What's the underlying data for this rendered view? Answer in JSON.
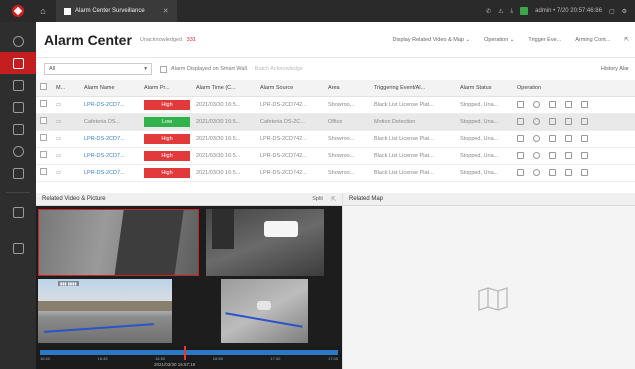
{
  "topbar": {
    "module_tab": "Alarm Center Surveillance",
    "user_text": "admin • 7/20 20:57:46:86"
  },
  "header": {
    "title": "Alarm Center",
    "subtitle": "Unacknowledged",
    "count": "331",
    "actions": [
      "Display Related Video & Map ⌄",
      "Operation ⌄",
      "Trigger Eve...",
      "Arming Cont...",
      "⇱"
    ]
  },
  "filter": {
    "select_value": "All",
    "smartwall_label": "Alarm Displayed on Smart Wall",
    "batch_label": "Batch Acknowledge",
    "history_label": "History Alar"
  },
  "table": {
    "columns": [
      "",
      "M...",
      "Alarm Name",
      "Alarm Pr...",
      "Alarm Time (C...",
      "Alarm Source",
      "Area",
      "Triggering Event/Al...",
      "Alarm Status",
      "Operation"
    ],
    "rows": [
      {
        "name": "LPR-DS-2CD7...",
        "priority": "High",
        "prio_class": "high",
        "time": "2021/03/30 16:5...",
        "source": "LPR-DS-2CD742...",
        "area": "Showroo...",
        "event": "Black List License Plat...",
        "status": "Stopped, Una...",
        "selected": false,
        "link": true
      },
      {
        "name": "Cafeteria DS...",
        "priority": "Low",
        "prio_class": "low",
        "time": "2021/03/30 16:5...",
        "source": "Cafeteria DS-2C...",
        "area": "Office",
        "event": "Motion Detection",
        "status": "Stopped, Una...",
        "selected": true,
        "link": false
      },
      {
        "name": "LPR-DS-2CD7...",
        "priority": "High",
        "prio_class": "high",
        "time": "2021/03/30 16:5...",
        "source": "LPR-DS-2CD742...",
        "area": "Showroo...",
        "event": "Black List License Plat...",
        "status": "Stopped, Una...",
        "selected": false,
        "link": true
      },
      {
        "name": "LPR-DS-2CD7...",
        "priority": "High",
        "prio_class": "high",
        "time": "2021/03/30 16:5...",
        "source": "LPR-DS-2CD742...",
        "area": "Showroo...",
        "event": "Black List License Plat...",
        "status": "Stopped, Una...",
        "selected": false,
        "link": true
      },
      {
        "name": "LPR-DS-2CD7...",
        "priority": "High",
        "prio_class": "high",
        "time": "2021/03/30 16:5...",
        "source": "LPR-DS-2CD742...",
        "area": "Showroo...",
        "event": "Black List License Plat...",
        "status": "Stopped, Una...",
        "selected": false,
        "link": true
      }
    ]
  },
  "video_panel": {
    "title": "Related Video & Picture",
    "split_label": "Split",
    "timeline_ticks": [
      "16:40",
      "16:45",
      "16:50",
      "16:55",
      "17:00",
      "17:05"
    ],
    "timeline_date": "2021/03/30 16:57:19"
  },
  "map_panel": {
    "title": "Related Map"
  },
  "colors": {
    "high": "#e23a3a",
    "low": "#2fb34a",
    "accent": "#c41e1e",
    "link": "#3b7fc7"
  }
}
